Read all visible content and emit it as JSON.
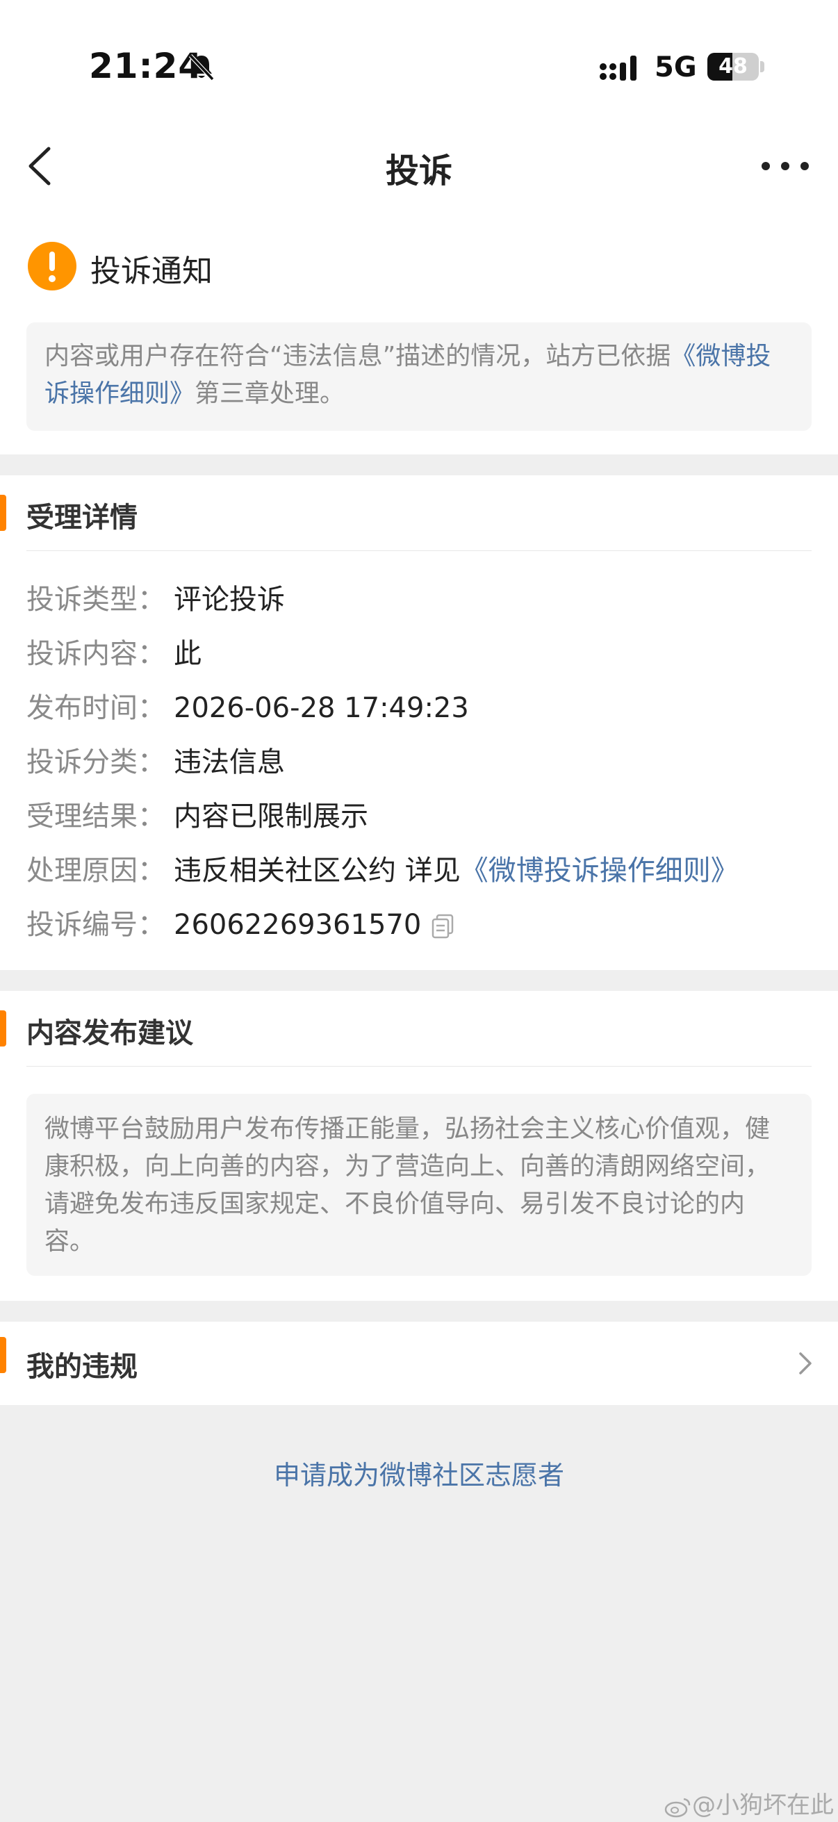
{
  "status_bar": {
    "time": "21:24",
    "network": "5G",
    "battery_text": "48",
    "battery_level": 0.48
  },
  "nav": {
    "title": "投诉"
  },
  "notice": {
    "title": "投诉通知",
    "text_before": "内容或用户存在符合“违法信息”描述的情况，站方已依据",
    "link": "《微博投诉操作细则》",
    "text_after": "第三章处理。"
  },
  "details": {
    "title": "受理详情",
    "rows": [
      {
        "label": "投诉类型：",
        "value": "评论投诉"
      },
      {
        "label": "投诉内容：",
        "value": "此"
      },
      {
        "label": "发布时间：",
        "value": "2026-06-28 17:49:23"
      },
      {
        "label": "投诉分类：",
        "value": "违法信息"
      },
      {
        "label": "受理结果：",
        "value": "内容已限制展示"
      },
      {
        "label": "处理原因：",
        "value": "违反相关社区公约 详见",
        "link": "《微博投诉操作细则》"
      },
      {
        "label": "投诉编号：",
        "value": "26062269361570"
      }
    ]
  },
  "advice": {
    "title": "内容发布建议",
    "text": "微博平台鼓励用户发布传播正能量，弘扬社会主义核心价值观，健康积极，向上向善的内容，为了营造向上、向善的清朗网络空间，请避免发布违反国家规定、不良价值导向、易引发不良讨论的内容。"
  },
  "violations": {
    "title": "我的违规"
  },
  "volunteer_link": "申请成为微博社区志愿者",
  "watermark": "@小狗坏在此",
  "colors": {
    "accent": "#ff8200",
    "link": "#4a74a8",
    "warning": "#ff9500"
  }
}
